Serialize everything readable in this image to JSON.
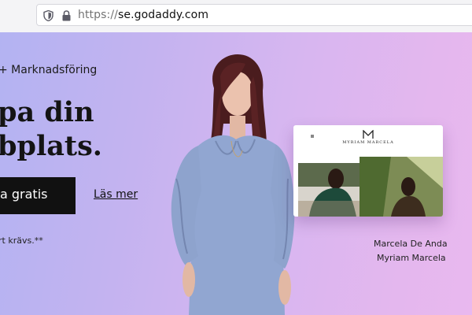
{
  "browser": {
    "url_scheme": "https://",
    "url_host": "se.godaddy.com",
    "icons": [
      "tracking-shield-icon",
      "lock-icon"
    ]
  },
  "hero": {
    "category": "+ Marknadsföring",
    "headline_line1": "pa din",
    "headline_line2": "bplats.",
    "cta_label": "a gratis",
    "learn_more": "Läs mer",
    "fineprint": "rt krävs.**",
    "preview": {
      "brand": "MYRIAM MARCELA",
      "logo_letter": "M"
    },
    "caption_name": "Marcela De Anda",
    "caption_site": "Myriam Marcela"
  },
  "colors": {
    "gradient_start": "#b3b3f2",
    "gradient_end": "#e9b8ef",
    "cta_bg": "#111111",
    "dress": "#8fa3cf"
  }
}
